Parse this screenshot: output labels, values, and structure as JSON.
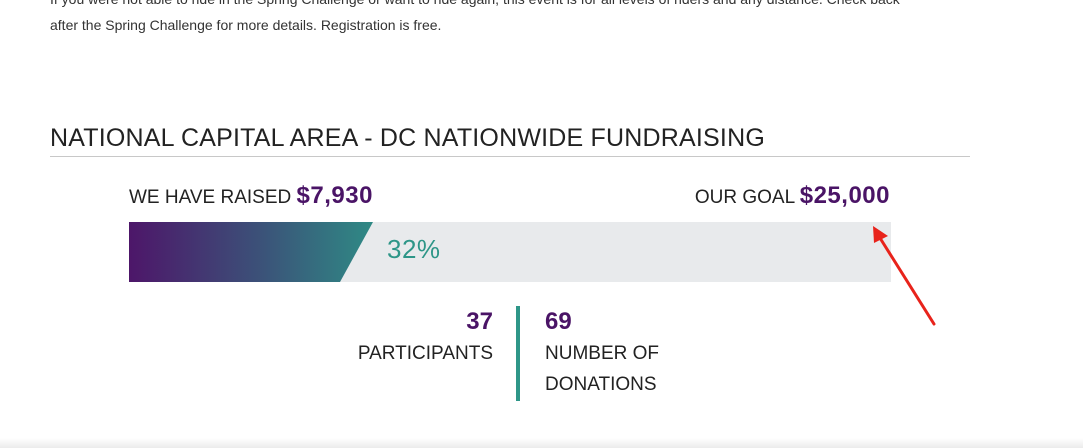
{
  "intro": {
    "line1": "If you were not able to ride in the Spring Challenge or want to ride again, this event is for all levels of riders and any distance. Check back",
    "line2": "after the Spring Challenge for more details. Registration is free."
  },
  "section": {
    "title": "NATIONAL CAPITAL AREA - DC NATIONWIDE FUNDRAISING"
  },
  "fundraising": {
    "raised_label": "WE HAVE RAISED",
    "raised_amount": "$7,930",
    "goal_label": "OUR GOAL",
    "goal_amount": "$25,000",
    "progress_label": "32%",
    "progress_fraction": 0.32
  },
  "stats": {
    "participants_count": "37",
    "participants_label": "PARTICIPANTS",
    "donations_count": "69",
    "donations_label_line1": "NUMBER OF",
    "donations_label_line2": "DONATIONS"
  },
  "colors": {
    "brand_purple": "#4a1466",
    "accent_teal": "#2e9688",
    "bar_track": "#e8eaec",
    "annotation_arrow": "#e8231b"
  },
  "annotation": {
    "icon": "red-arrow-icon"
  }
}
